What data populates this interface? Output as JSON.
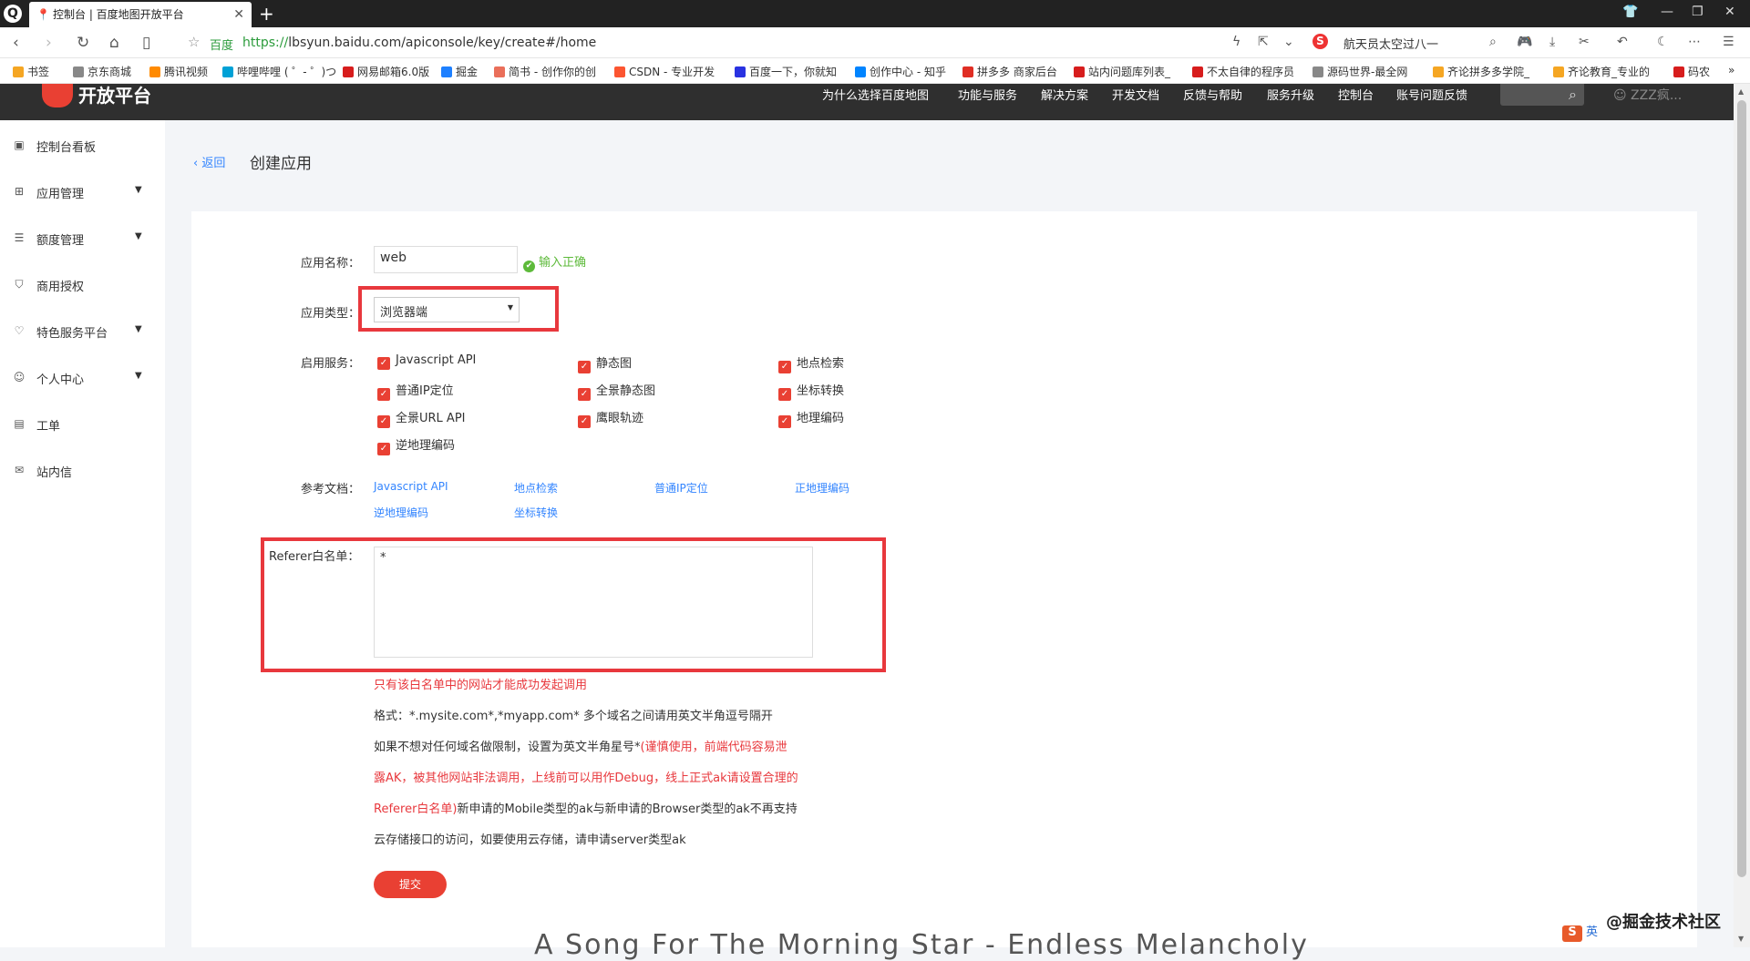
{
  "browser": {
    "tab_title": "控制台 | 百度地图开放平台",
    "site_label": "百度",
    "url_scheme": "https://",
    "url_rest": "lbsyun.baidu.com/apiconsole/key/create#/home",
    "search_text": "航天员太空过八一",
    "bookmarks": [
      {
        "label": "书签",
        "color": "#f5a623"
      },
      {
        "label": "京东商城",
        "color": "#888888"
      },
      {
        "label": "腾讯视频",
        "color": "#ff8a00"
      },
      {
        "label": "哔哩哔哩 ( ゜- ゜)つ",
        "color": "#00a1d6"
      },
      {
        "label": "网易邮箱6.0版",
        "color": "#d71d1d"
      },
      {
        "label": "掘金",
        "color": "#1e80ff"
      },
      {
        "label": "简书 - 创作你的创",
        "color": "#ea6f5a"
      },
      {
        "label": "CSDN - 专业开发",
        "color": "#fc5531"
      },
      {
        "label": "百度一下，你就知",
        "color": "#2932e1"
      },
      {
        "label": "创作中心 - 知乎",
        "color": "#0084ff"
      },
      {
        "label": "拼多多 商家后台",
        "color": "#e02e24"
      },
      {
        "label": "站内问题库列表_",
        "color": "#d71d1d"
      },
      {
        "label": "不太自律的程序员",
        "color": "#d71d1d"
      },
      {
        "label": "源码世界-最全网",
        "color": "#888888"
      },
      {
        "label": "齐论拼多多学院_",
        "color": "#f5a623"
      },
      {
        "label": "齐论教育_专业的",
        "color": "#f5a623"
      },
      {
        "label": "码农",
        "color": "#d71d1d"
      }
    ]
  },
  "site": {
    "brand": "开放平台",
    "nav": [
      "为什么选择百度地图",
      "功能与服务",
      "解决方案",
      "开发文档",
      "反馈与帮助",
      "服务升级",
      "控制台",
      "账号问题反馈"
    ],
    "user": "ZZZ疯..."
  },
  "sidebar": {
    "items": [
      {
        "label": "控制台看板",
        "icon": "dashboard-icon",
        "glyph": "▣",
        "caret": false
      },
      {
        "label": "应用管理",
        "icon": "grid-icon",
        "glyph": "⊞",
        "caret": true
      },
      {
        "label": "额度管理",
        "icon": "sliders-icon",
        "glyph": "☰",
        "caret": true
      },
      {
        "label": "商用授权",
        "icon": "shield-icon",
        "glyph": "⛉",
        "caret": false
      },
      {
        "label": "特色服务平台",
        "icon": "heart-icon",
        "glyph": "♡",
        "caret": true
      },
      {
        "label": "个人中心",
        "icon": "user-icon",
        "glyph": "☺",
        "caret": true
      },
      {
        "label": "工单",
        "icon": "clipboard-icon",
        "glyph": "▤",
        "caret": false
      },
      {
        "label": "站内信",
        "icon": "mail-icon",
        "glyph": "✉",
        "caret": false
      }
    ]
  },
  "page": {
    "back_label": "返回",
    "title": "创建应用"
  },
  "form": {
    "app_name_label": "应用名称：",
    "app_name_value": "web",
    "app_name_ok": "输入正确",
    "app_type_label": "应用类型：",
    "app_type_value": "浏览器端",
    "services_label": "启用服务：",
    "services": [
      [
        "Javascript API",
        "静态图",
        "地点检索"
      ],
      [
        "普通IP定位",
        "全景静态图",
        "坐标转换"
      ],
      [
        "全景URL API",
        "鹰眼轨迹",
        "地理编码"
      ],
      [
        "逆地理编码"
      ]
    ],
    "docs_label": "参考文档：",
    "docs": [
      [
        "Javascript API",
        "地点检索",
        "普通IP定位",
        "正地理编码"
      ],
      [
        "逆地理编码",
        "坐标转换"
      ]
    ],
    "referer_label": "Referer白名单：",
    "referer_value": "*",
    "notes": {
      "warning": "只有该白名单中的网站才能成功发起调用",
      "format": "格式：*.mysite.com*,*myapp.com* 多个域名之间请用英文半角逗号隔开",
      "line3_normal": "如果不想对任何域名做限制，设置为英文半角星号*",
      "line3_red": "(谨慎使用，前端代码容易泄",
      "line4_red": "露AK，被其他网站非法调用，上线前可以用作Debug，线上正式ak请设置合理的",
      "line5_red": "Referer白名单)",
      "line5_normal": "新申请的Mobile类型的ak与新申请的Browser类型的ak不再支持",
      "line6": "云存储接口的访问，如要使用云存储，请申请server类型ak"
    },
    "submit_label": "提交"
  },
  "overlay_text": "A Song For The Morning Star - Endless Melancholy",
  "watermark": "@掘金技术社区",
  "ime_text": "英"
}
